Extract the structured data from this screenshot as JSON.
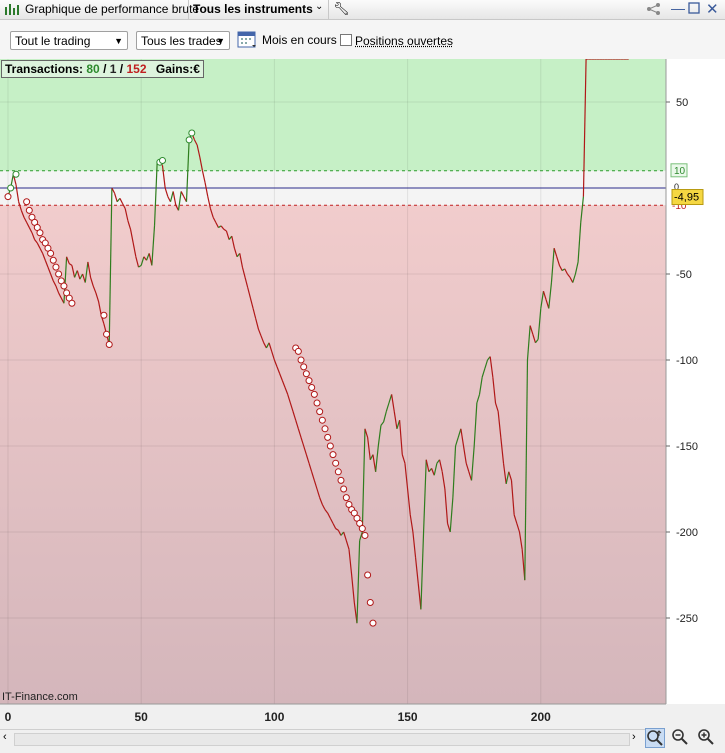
{
  "window": {
    "title": "Graphique de performance brute",
    "instrument_selector": "Tous les instruments"
  },
  "toolbar": {
    "trading_select": "Tout le trading",
    "trades_select": "Tous les trades",
    "month_label": "Mois en cours",
    "open_positions_label": "Positions ouvertes",
    "open_positions_checked": false
  },
  "info": {
    "transactions_label": "Transactions:",
    "wins": "80",
    "sep1": "/",
    "neutral": "1",
    "sep2": "/",
    "losses": "152",
    "gains_label": "Gains:",
    "currency": "€"
  },
  "watermark": "IT-Finance.com",
  "colors": {
    "profit_zone": "#c6f0c6",
    "loss_zone_top": "#f0c8c8",
    "loss_zone_bottom": "#d8b8bc",
    "up_segment": "#2f7d1e",
    "down_segment": "#b01818",
    "zero_line": "#2a2a8a",
    "current_value_bg": "#f5d742"
  },
  "chart_data": {
    "type": "line",
    "x_ticks": [
      0,
      50,
      100,
      150,
      200
    ],
    "y_ticks": [
      50,
      -50,
      -100,
      -150,
      -200,
      -250
    ],
    "xlim": [
      -3,
      247
    ],
    "ylim": [
      -300,
      75
    ],
    "profit_threshold": 10,
    "loss_threshold": -10,
    "threshold_labels": [
      "10",
      "-10"
    ],
    "zero_tick_label": "0",
    "current_value": -4.95,
    "current_value_label": "-4,95",
    "x": [
      0,
      1,
      2,
      3,
      4,
      5,
      6,
      7,
      8,
      9,
      10,
      11,
      12,
      13,
      14,
      15,
      16,
      17,
      18,
      19,
      20,
      21,
      22,
      23,
      24,
      25,
      26,
      27,
      28,
      29,
      30,
      31,
      32,
      33,
      34,
      35,
      36,
      37,
      38,
      39,
      40,
      41,
      42,
      43,
      44,
      45,
      46,
      47,
      48,
      49,
      50,
      51,
      52,
      53,
      54,
      55,
      56,
      57,
      58,
      59,
      60,
      61,
      62,
      63,
      64,
      65,
      66,
      67,
      68,
      69,
      70,
      71,
      72,
      73,
      74,
      75,
      76,
      77,
      78,
      79,
      80,
      81,
      82,
      83,
      84,
      85,
      86,
      87,
      88,
      89,
      90,
      91,
      92,
      93,
      94,
      95,
      96,
      97,
      98,
      99,
      100,
      101,
      102,
      103,
      104,
      105,
      106,
      107,
      108,
      109,
      110,
      111,
      112,
      113,
      114,
      115,
      116,
      117,
      118,
      119,
      120,
      121,
      122,
      123,
      124,
      125,
      126,
      127,
      128,
      129,
      130,
      131,
      132,
      133,
      134,
      135,
      136,
      137,
      138,
      139,
      140,
      141,
      142,
      143,
      144,
      145,
      146,
      147,
      148,
      149,
      150,
      151,
      152,
      153,
      154,
      155,
      156,
      157,
      158,
      159,
      160,
      161,
      162,
      163,
      164,
      165,
      166,
      167,
      168,
      169,
      170,
      171,
      172,
      173,
      174,
      175,
      176,
      177,
      178,
      179,
      180,
      181,
      182,
      183,
      184,
      185,
      186,
      187,
      188,
      189,
      190,
      191,
      192,
      193,
      194,
      195,
      196,
      197,
      198,
      199,
      200,
      201,
      202,
      203,
      204,
      205,
      206,
      207,
      208,
      209,
      210,
      211,
      212,
      213,
      214,
      215,
      216,
      217,
      218,
      219,
      220,
      221,
      222,
      223,
      224,
      225,
      226,
      227,
      228,
      229,
      230,
      231,
      232,
      233
    ],
    "y": [
      -5,
      0,
      8,
      2,
      -8,
      -13,
      -17,
      -20,
      -23,
      -26,
      -30,
      -32,
      -35,
      -38,
      -42,
      -46,
      -50,
      -54,
      -57,
      -61,
      -64,
      -67,
      -40,
      -44,
      -45,
      -52,
      -48,
      -53,
      -50,
      -55,
      -43,
      -52,
      -57,
      -61,
      -66,
      -74,
      -79,
      -85,
      -91,
      0,
      -3,
      -8,
      -6,
      -9,
      -12,
      -19,
      -24,
      -32,
      -40,
      -46,
      -45,
      -40,
      -42,
      -38,
      -45,
      -22,
      15,
      16,
      13,
      0,
      -5,
      -8,
      -2,
      -10,
      -13,
      -2,
      -5,
      -8,
      28,
      32,
      28,
      25,
      18,
      10,
      3,
      -5,
      -12,
      -17,
      -20,
      -23,
      -22,
      -24,
      -25,
      -30,
      -28,
      -35,
      -40,
      -38,
      -46,
      -52,
      -58,
      -64,
      -70,
      -76,
      -82,
      -86,
      -90,
      -93,
      -90,
      -95,
      -100,
      -104,
      -108,
      -112,
      -116,
      -120,
      -125,
      -130,
      -135,
      -140,
      -145,
      -150,
      -155,
      -160,
      -165,
      -170,
      -175,
      -180,
      -184,
      -187,
      -189,
      -192,
      -195,
      -198,
      -199,
      -202,
      -200,
      -205,
      -210,
      -225,
      -241,
      -253,
      -205,
      -200,
      -140,
      -145,
      -158,
      -155,
      -165,
      -150,
      -138,
      -136,
      -130,
      -125,
      -120,
      -130,
      -140,
      -135,
      -155,
      -160,
      -175,
      -190,
      -200,
      -215,
      -230,
      -245,
      -200,
      -158,
      -165,
      -163,
      -167,
      -160,
      -158,
      -165,
      -175,
      -195,
      -200,
      -180,
      -150,
      -145,
      -140,
      -150,
      -160,
      -165,
      -170,
      -150,
      -125,
      -120,
      -110,
      -105,
      -100,
      -98,
      -110,
      -125,
      -130,
      -145,
      -160,
      -172,
      -165,
      -170,
      -190,
      -195,
      -200,
      -210,
      -228,
      -100,
      -80,
      -85,
      -90,
      -88,
      -70,
      -60,
      -65,
      -70,
      -55,
      -35,
      -40,
      -45,
      -48,
      -47,
      -50,
      -52,
      -55,
      -50,
      -43,
      -20,
      -5
    ],
    "trade_markers": [
      {
        "x": 1,
        "y": 0,
        "result": "win"
      },
      {
        "x": 3,
        "y": 8,
        "result": "win"
      },
      {
        "x": 0,
        "y": -5,
        "result": "loss"
      },
      {
        "x": 7,
        "y": -8,
        "result": "loss"
      },
      {
        "x": 8,
        "y": -13,
        "result": "loss"
      },
      {
        "x": 9,
        "y": -17,
        "result": "loss"
      },
      {
        "x": 10,
        "y": -20,
        "result": "loss"
      },
      {
        "x": 11,
        "y": -23,
        "result": "loss"
      },
      {
        "x": 12,
        "y": -26,
        "result": "loss"
      },
      {
        "x": 13,
        "y": -30,
        "result": "loss"
      },
      {
        "x": 14,
        "y": -32,
        "result": "loss"
      },
      {
        "x": 15,
        "y": -35,
        "result": "loss"
      },
      {
        "x": 16,
        "y": -38,
        "result": "loss"
      },
      {
        "x": 17,
        "y": -42,
        "result": "loss"
      },
      {
        "x": 18,
        "y": -46,
        "result": "loss"
      },
      {
        "x": 19,
        "y": -50,
        "result": "loss"
      },
      {
        "x": 20,
        "y": -54,
        "result": "loss"
      },
      {
        "x": 21,
        "y": -57,
        "result": "loss"
      },
      {
        "x": 22,
        "y": -61,
        "result": "loss"
      },
      {
        "x": 23,
        "y": -64,
        "result": "loss"
      },
      {
        "x": 24,
        "y": -67,
        "result": "loss"
      },
      {
        "x": 36,
        "y": -74,
        "result": "loss"
      },
      {
        "x": 37,
        "y": -85,
        "result": "loss"
      },
      {
        "x": 38,
        "y": -91,
        "result": "loss"
      },
      {
        "x": 57,
        "y": 15,
        "result": "win"
      },
      {
        "x": 58,
        "y": 16,
        "result": "win"
      },
      {
        "x": 68,
        "y": 28,
        "result": "win"
      },
      {
        "x": 69,
        "y": 32,
        "result": "win"
      },
      {
        "x": 108,
        "y": -93,
        "result": "loss"
      },
      {
        "x": 109,
        "y": -95,
        "result": "loss"
      },
      {
        "x": 110,
        "y": -100,
        "result": "loss"
      },
      {
        "x": 111,
        "y": -104,
        "result": "loss"
      },
      {
        "x": 112,
        "y": -108,
        "result": "loss"
      },
      {
        "x": 113,
        "y": -112,
        "result": "loss"
      },
      {
        "x": 114,
        "y": -116,
        "result": "loss"
      },
      {
        "x": 115,
        "y": -120,
        "result": "loss"
      },
      {
        "x": 116,
        "y": -125,
        "result": "loss"
      },
      {
        "x": 117,
        "y": -130,
        "result": "loss"
      },
      {
        "x": 118,
        "y": -135,
        "result": "loss"
      },
      {
        "x": 119,
        "y": -140,
        "result": "loss"
      },
      {
        "x": 120,
        "y": -145,
        "result": "loss"
      },
      {
        "x": 121,
        "y": -150,
        "result": "loss"
      },
      {
        "x": 122,
        "y": -155,
        "result": "loss"
      },
      {
        "x": 123,
        "y": -160,
        "result": "loss"
      },
      {
        "x": 124,
        "y": -165,
        "result": "loss"
      },
      {
        "x": 125,
        "y": -170,
        "result": "loss"
      },
      {
        "x": 126,
        "y": -175,
        "result": "loss"
      },
      {
        "x": 127,
        "y": -180,
        "result": "loss"
      },
      {
        "x": 128,
        "y": -184,
        "result": "loss"
      },
      {
        "x": 129,
        "y": -187,
        "result": "loss"
      },
      {
        "x": 130,
        "y": -189,
        "result": "loss"
      },
      {
        "x": 131,
        "y": -192,
        "result": "loss"
      },
      {
        "x": 132,
        "y": -195,
        "result": "loss"
      },
      {
        "x": 133,
        "y": -198,
        "result": "loss"
      },
      {
        "x": 134,
        "y": -202,
        "result": "loss"
      },
      {
        "x": 135,
        "y": -225,
        "result": "loss"
      },
      {
        "x": 136,
        "y": -241,
        "result": "loss"
      },
      {
        "x": 137,
        "y": -253,
        "result": "loss"
      }
    ],
    "grid": true
  }
}
